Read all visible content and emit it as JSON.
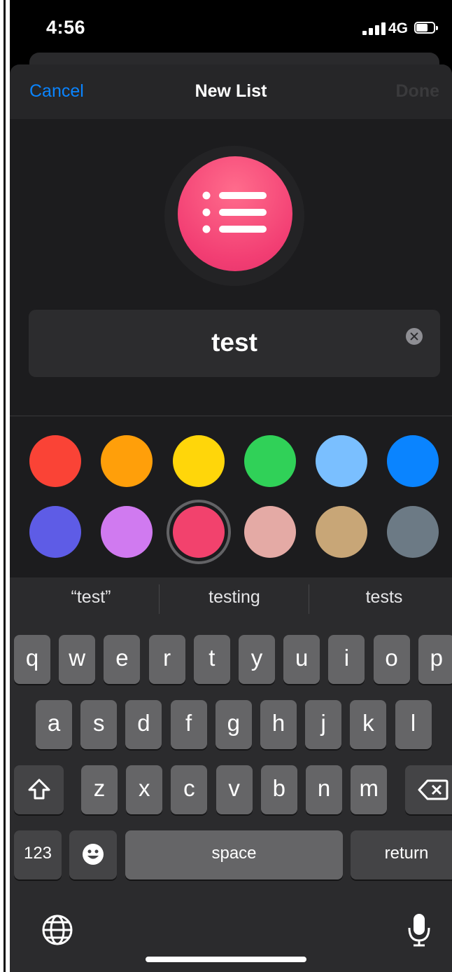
{
  "status_bar": {
    "time": "4:56",
    "network": "4G",
    "battery_icon": "battery-icon",
    "signal_icon": "signal-bars-icon"
  },
  "nav": {
    "cancel_label": "Cancel",
    "title": "New List",
    "done_label": "Done"
  },
  "list_icon": {
    "icon": "list-bullet-icon",
    "color": "#f23e73"
  },
  "name_field": {
    "value": "test",
    "clear_icon": "clear-text-icon"
  },
  "colors": {
    "selected": "#f2426d",
    "options": [
      {
        "name": "red",
        "hex": "#fa4336"
      },
      {
        "name": "orange",
        "hex": "#ff9f0a"
      },
      {
        "name": "yellow",
        "hex": "#ffd60a"
      },
      {
        "name": "green",
        "hex": "#30d158"
      },
      {
        "name": "light-blue",
        "hex": "#7abfff"
      },
      {
        "name": "blue",
        "hex": "#0a84ff"
      },
      {
        "name": "indigo",
        "hex": "#5e5ce6"
      },
      {
        "name": "purple",
        "hex": "#d07af0"
      },
      {
        "name": "pink",
        "hex": "#f2426d"
      },
      {
        "name": "rose",
        "hex": "#e4aaa5"
      },
      {
        "name": "tan",
        "hex": "#c8a677"
      },
      {
        "name": "gray",
        "hex": "#6c7a85"
      }
    ]
  },
  "suggestions": [
    "“test”",
    "testing",
    "tests"
  ],
  "keyboard": {
    "row1": [
      "q",
      "w",
      "e",
      "r",
      "t",
      "y",
      "u",
      "i",
      "o",
      "p"
    ],
    "row2": [
      "a",
      "s",
      "d",
      "f",
      "g",
      "h",
      "j",
      "k",
      "l"
    ],
    "row3": [
      "z",
      "x",
      "c",
      "v",
      "b",
      "n",
      "m"
    ],
    "numbers_label": "123",
    "space_label": "space",
    "return_label": "return",
    "shift_icon": "shift-icon",
    "delete_icon": "delete-icon",
    "emoji_icon": "emoji-icon",
    "globe_icon": "globe-icon",
    "mic_icon": "microphone-icon"
  }
}
